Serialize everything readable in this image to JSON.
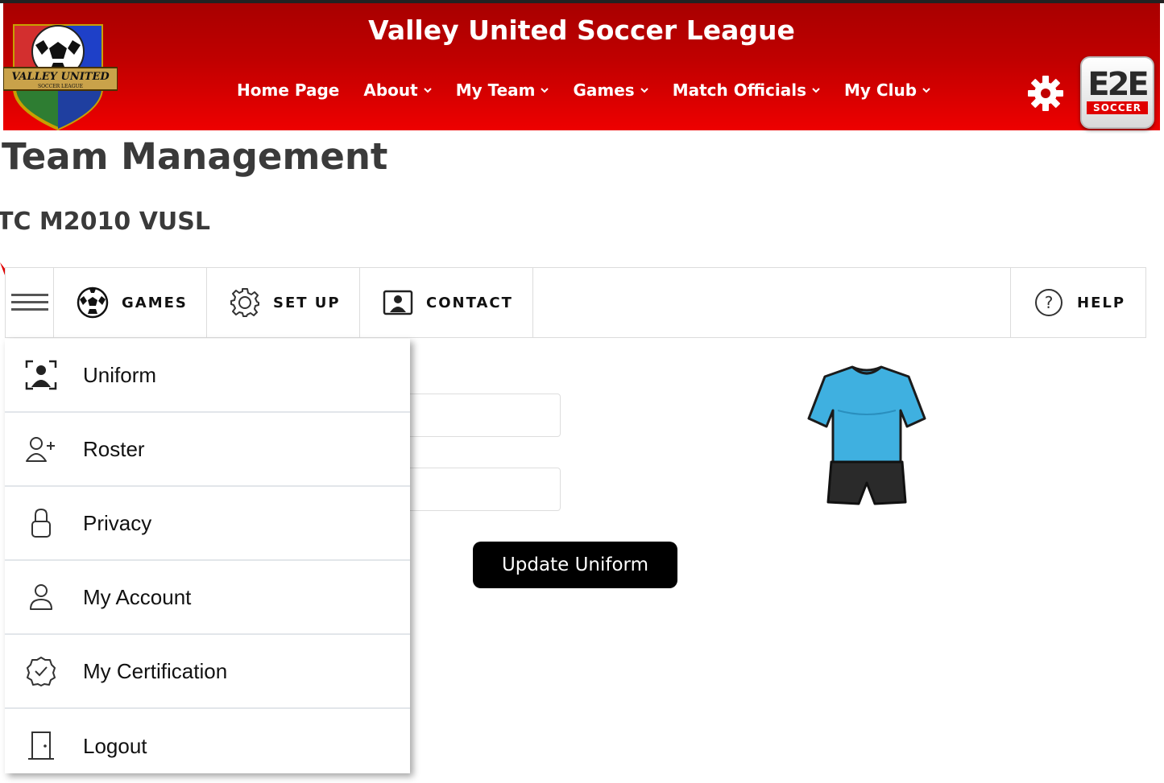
{
  "header": {
    "site_title": "Valley United Soccer League",
    "logo_text": "VALLEY UNITED",
    "logo_subtext": "SOCCER LEAGUE",
    "brand_badge_top": "E2E",
    "brand_badge_bottom": "SOCCER",
    "nav": [
      {
        "label": "Home Page",
        "has_dropdown": false
      },
      {
        "label": "About",
        "has_dropdown": true
      },
      {
        "label": "My Team",
        "has_dropdown": true
      },
      {
        "label": "Games",
        "has_dropdown": true
      },
      {
        "label": "Match Officials",
        "has_dropdown": true
      },
      {
        "label": "My Club",
        "has_dropdown": true
      }
    ],
    "colors": {
      "header_red": "#d00000",
      "text": "#ffffff"
    }
  },
  "page": {
    "title": "Team Management",
    "team_name": "TC M2010 VUSL"
  },
  "toolbar": {
    "menu_icon": "hamburger-icon",
    "games": {
      "label": "GAMES",
      "icon": "soccer-ball-icon"
    },
    "setup": {
      "label": "SET UP",
      "icon": "gear-icon"
    },
    "contact": {
      "label": "CONTACT",
      "icon": "contact-card-icon"
    },
    "help": {
      "label": "HELP",
      "icon": "question-icon"
    }
  },
  "form": {
    "update_button": "Update Uniform",
    "jersey_color": "#3fb0e0",
    "shorts_color": "#222222"
  },
  "dropdown": {
    "items": [
      {
        "label": "Uniform",
        "icon": "portrait-icon"
      },
      {
        "label": "Roster",
        "icon": "add-user-icon"
      },
      {
        "label": "Privacy",
        "icon": "lock-icon"
      },
      {
        "label": "My Account",
        "icon": "user-icon"
      },
      {
        "label": "My Certification",
        "icon": "certification-badge-icon"
      },
      {
        "label": "Logout",
        "icon": "door-icon"
      }
    ]
  }
}
